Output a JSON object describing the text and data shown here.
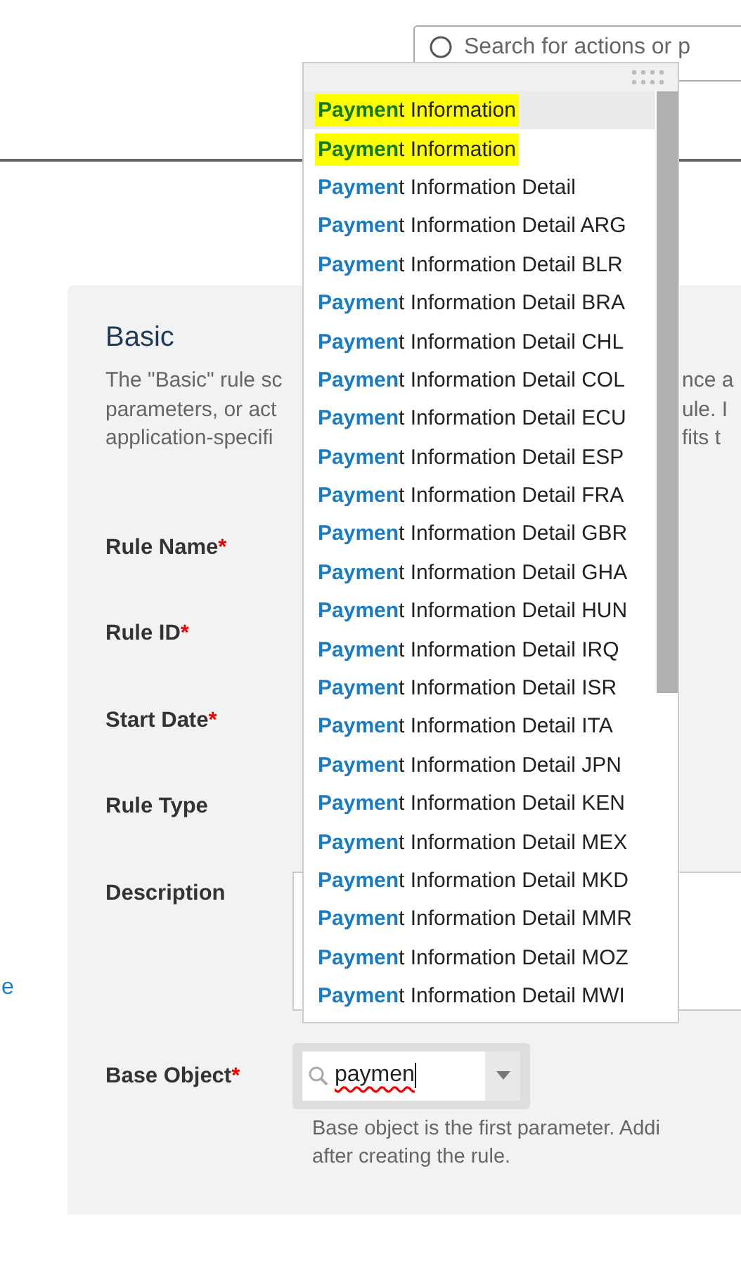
{
  "header": {
    "search": {
      "placeholder": "Search for actions or p"
    }
  },
  "section": {
    "title": "Basic",
    "description_left": [
      "The \"Basic\" rule sc",
      "parameters, or act",
      "application-specifi"
    ],
    "description_right": [
      "nce a",
      "ule. I",
      "fits t"
    ],
    "fields": [
      {
        "label": "Rule Name",
        "required_mark": "*",
        "kind": "plain"
      },
      {
        "label": "Rule ID",
        "required_mark": "*",
        "kind": "plain"
      },
      {
        "label": "Start Date",
        "required_mark": "*",
        "kind": "plain"
      },
      {
        "label": "Rule Type",
        "kind": "plain"
      },
      {
        "label": "Description",
        "kind": "textarea"
      },
      {
        "label": "Base Object",
        "required_mark": "*",
        "kind": "combo",
        "value": "paymen",
        "hint": [
          "Base object is the first parameter. Addi",
          "after creating the rule."
        ]
      }
    ]
  },
  "side_link": "e",
  "dropdown": {
    "items": [
      {
        "text": "**Paymen**t Information",
        "selected": true,
        "highlighted": true
      },
      {
        "text": "**Paymen**t Information",
        "selected": false,
        "highlighted": true
      },
      {
        "text": "**Paymen**t Information Detail",
        "selected": false,
        "highlighted": false
      },
      {
        "text": "**Paymen**t Information Detail ARG",
        "selected": false,
        "highlighted": false
      },
      {
        "text": "**Paymen**t Information Detail BLR",
        "selected": false,
        "highlighted": false
      },
      {
        "text": "**Paymen**t Information Detail BRA",
        "selected": false,
        "highlighted": false
      },
      {
        "text": "**Paymen**t Information Detail CHL",
        "selected": false,
        "highlighted": false
      },
      {
        "text": "**Paymen**t Information Detail COL",
        "selected": false,
        "highlighted": false
      },
      {
        "text": "**Paymen**t Information Detail ECU",
        "selected": false,
        "highlighted": false
      },
      {
        "text": "**Paymen**t Information Detail ESP",
        "selected": false,
        "highlighted": false
      },
      {
        "text": "**Paymen**t Information Detail FRA",
        "selected": false,
        "highlighted": false
      },
      {
        "text": "**Paymen**t Information Detail GBR",
        "selected": false,
        "highlighted": false
      },
      {
        "text": "**Paymen**t Information Detail GHA",
        "selected": false,
        "highlighted": false
      },
      {
        "text": "**Paymen**t Information Detail HUN",
        "selected": false,
        "highlighted": false
      },
      {
        "text": "**Paymen**t Information Detail IRQ",
        "selected": false,
        "highlighted": false
      },
      {
        "text": "**Paymen**t Information Detail ISR",
        "selected": false,
        "highlighted": false
      },
      {
        "text": "**Paymen**t Information Detail ITA",
        "selected": false,
        "highlighted": false
      },
      {
        "text": "**Paymen**t Information Detail JPN",
        "selected": false,
        "highlighted": false
      },
      {
        "text": "**Paymen**t Information Detail KEN",
        "selected": false,
        "highlighted": false
      },
      {
        "text": "**Paymen**t Information Detail MEX",
        "selected": false,
        "highlighted": false
      },
      {
        "text": "**Paymen**t Information Detail MKD",
        "selected": false,
        "highlighted": false
      },
      {
        "text": "**Paymen**t Information Detail MMR",
        "selected": false,
        "highlighted": false
      },
      {
        "text": "**Paymen**t Information Detail MOZ",
        "selected": false,
        "highlighted": false
      },
      {
        "text": "**Paymen**t Information Detail MWI",
        "selected": false,
        "highlighted": false
      }
    ]
  }
}
